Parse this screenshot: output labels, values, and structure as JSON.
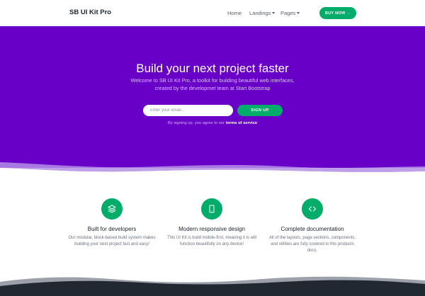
{
  "navbar": {
    "brand": "SB UI Kit Pro",
    "links": [
      {
        "label": "Home"
      },
      {
        "label": "Landings"
      },
      {
        "label": "Pages"
      }
    ],
    "buy_button": "BUY NOW →"
  },
  "hero": {
    "title": "Build your next project faster",
    "subtitle_line1": "Welcome to SB UI Kit Pro, a toolkit for building beautiful web interfaces,",
    "subtitle_line2": "created by the developmet team at Start Bootstrap",
    "email_placeholder": "Enter your email...",
    "signup_button": "SIGN UP",
    "terms_prefix": "By signing up, you agree to our ",
    "terms_link": "terms of service"
  },
  "features": [
    {
      "icon": "layers-icon",
      "title": "Built for developers",
      "description": "Our modular, block-based build system makes building your next project fast and easy!"
    },
    {
      "icon": "smartphone-icon",
      "title": "Modern responsive design",
      "description": "This UI Kit is build mobile-first, meaning it is will function beautifully on any device!"
    },
    {
      "icon": "code-icon",
      "title": "Complete documentation",
      "description": "All of the layouts, page sections, components, and utilities are fully covered in this products docs."
    }
  ],
  "colors": {
    "hero_purple": "#6900c7",
    "accent_green": "#00ac69",
    "footer_dark": "#212832"
  }
}
